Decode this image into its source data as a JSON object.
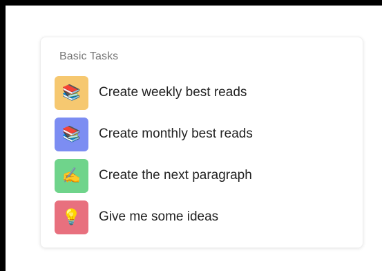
{
  "panel": {
    "title": "Basic Tasks",
    "tasks": [
      {
        "label": "Create weekly best reads",
        "icon": "books-icon",
        "glyph": "📚",
        "color": "#F6C870"
      },
      {
        "label": "Create monthly best reads",
        "icon": "books-icon",
        "glyph": "📚",
        "color": "#7C8DF2"
      },
      {
        "label": "Create the next paragraph",
        "icon": "writing-hand-icon",
        "glyph": "✍️",
        "color": "#6FD48B"
      },
      {
        "label": "Give me some ideas",
        "icon": "light-bulb-icon",
        "glyph": "💡",
        "color": "#E8707E"
      }
    ]
  }
}
